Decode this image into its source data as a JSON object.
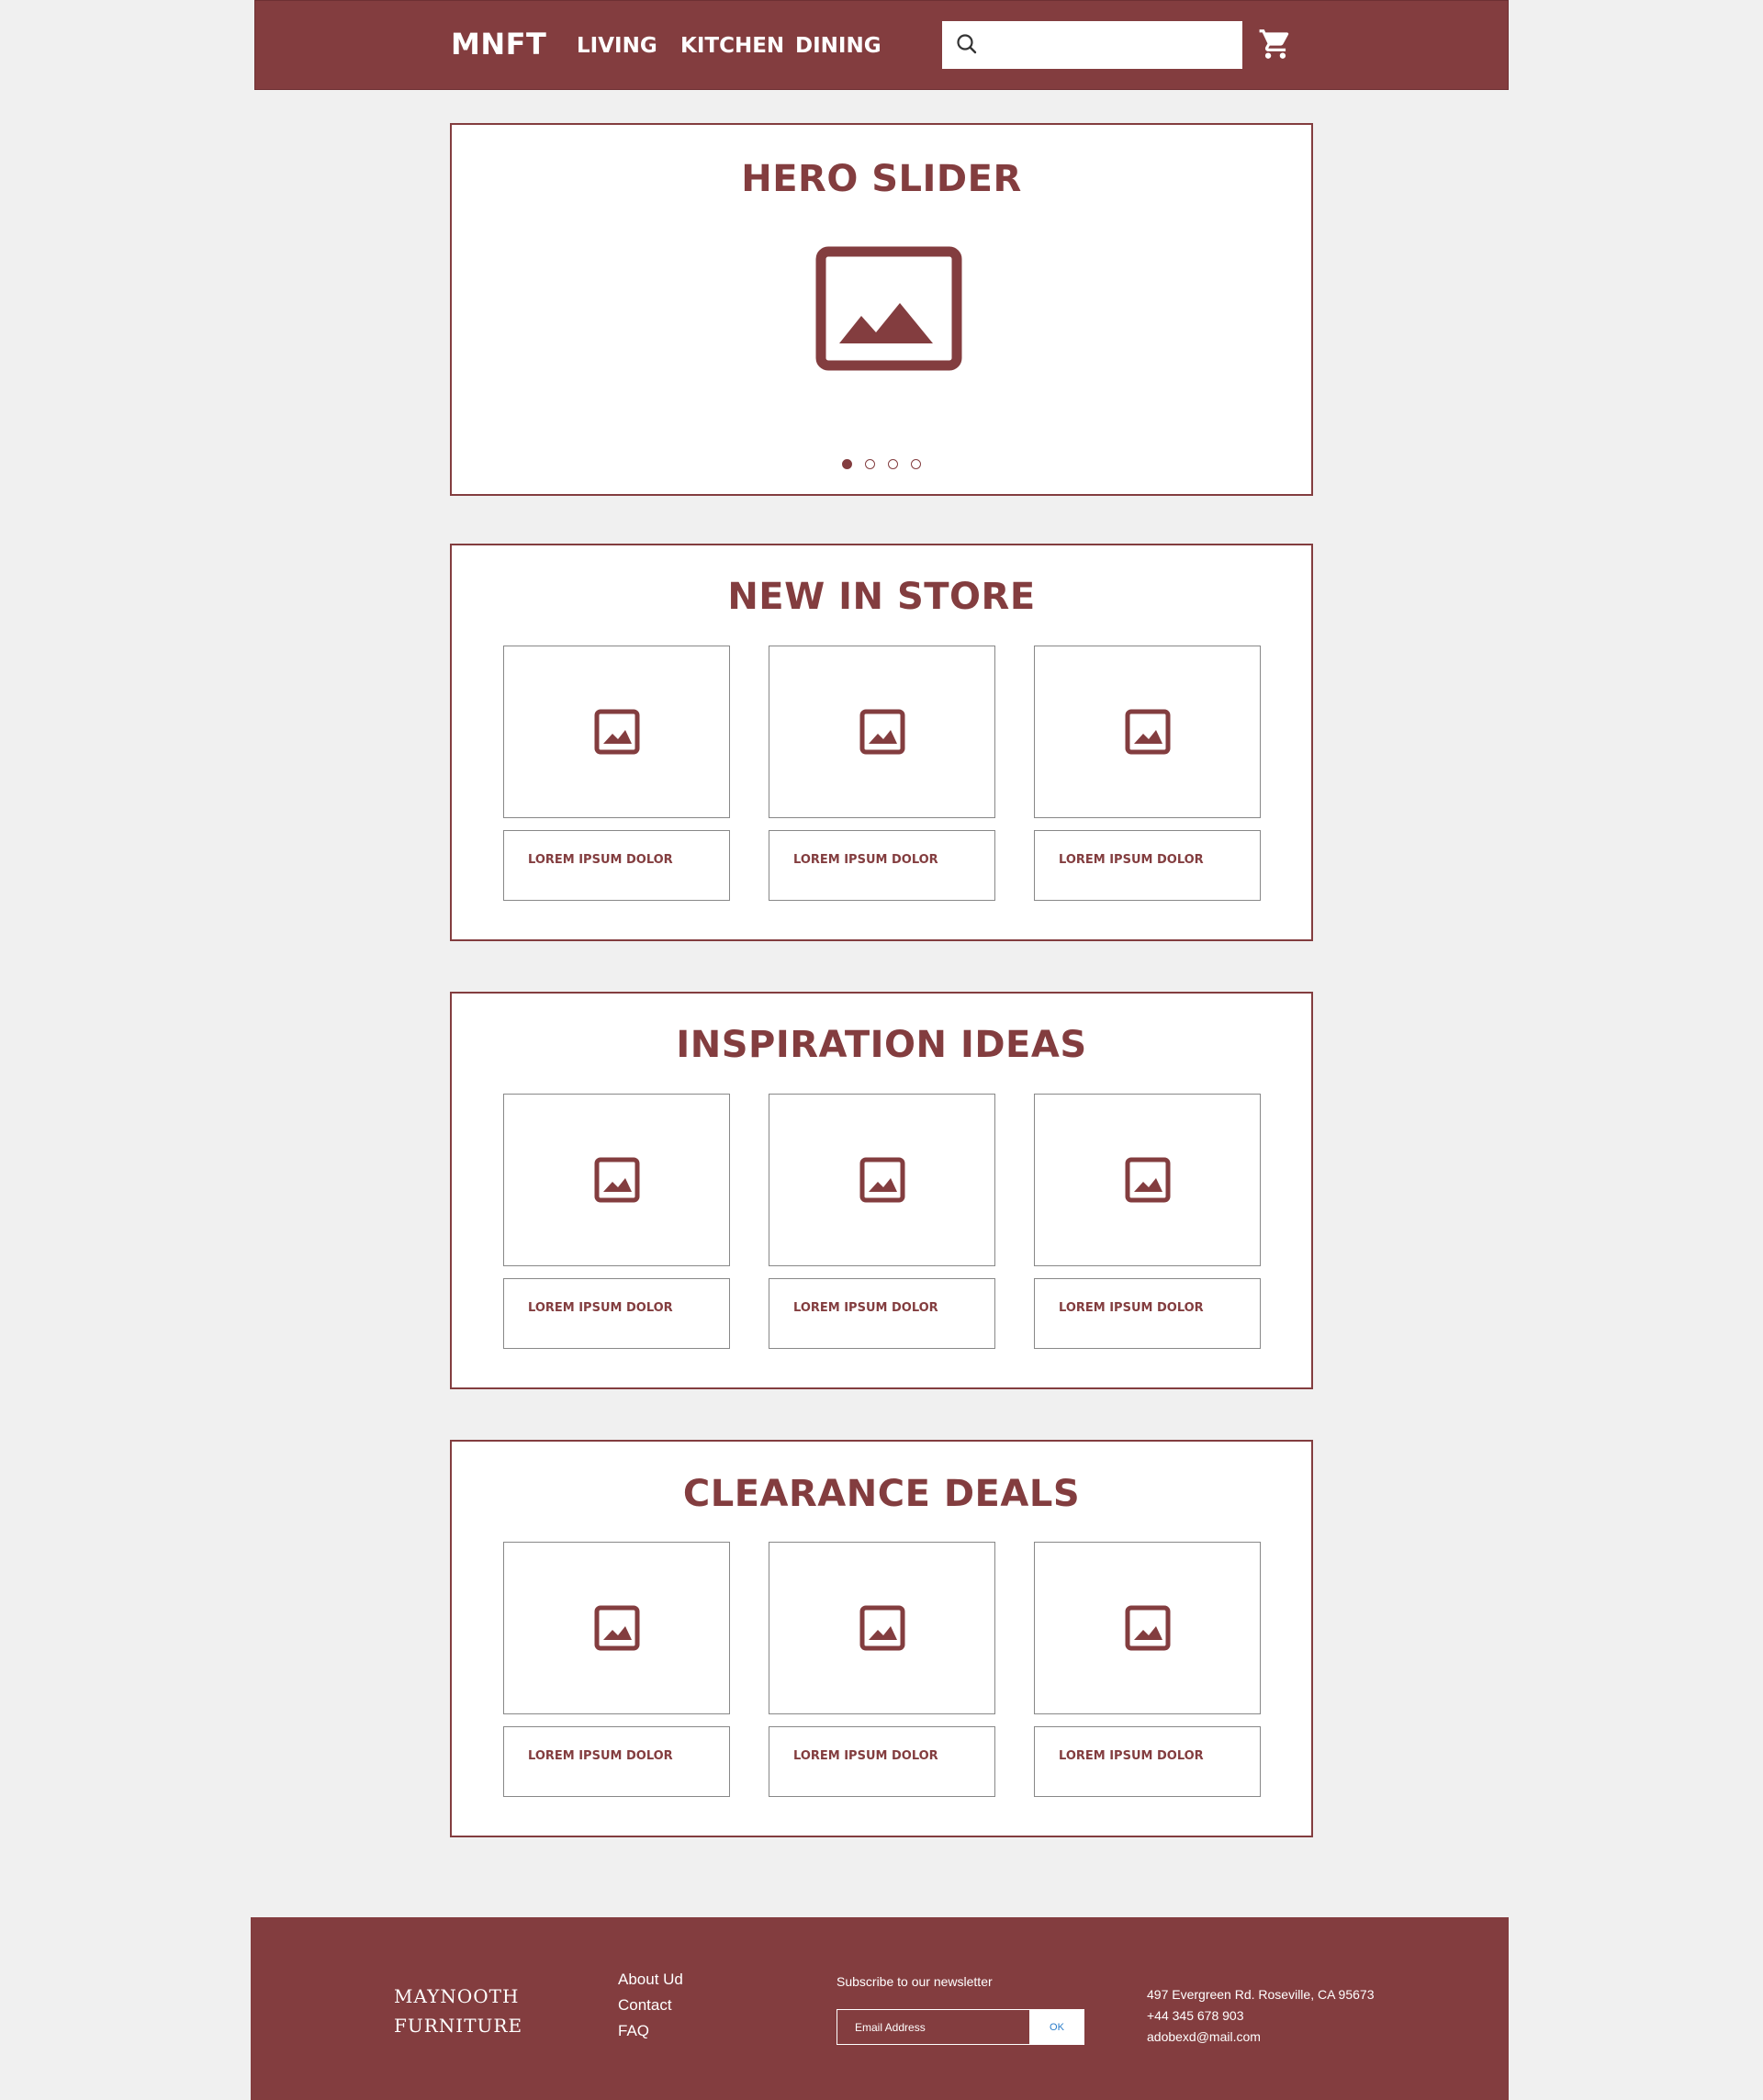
{
  "header": {
    "brand": "MNFT",
    "nav": [
      "LIVING",
      "KITCHEN",
      "DINING"
    ],
    "search": {
      "placeholder": "",
      "value": ""
    },
    "icons": {
      "search": "search-icon",
      "cart": "cart-icon"
    }
  },
  "hero": {
    "title": "HERO SLIDER",
    "image_icon": "image-placeholder-icon",
    "slides_total": 4,
    "active_slide": 1
  },
  "sections": [
    {
      "title": "NEW IN STORE",
      "cards": [
        "LOREM IPSUM DOLOR",
        "LOREM IPSUM DOLOR",
        "LOREM IPSUM DOLOR"
      ]
    },
    {
      "title": "INSPIRATION IDEAS",
      "cards": [
        "LOREM IPSUM DOLOR",
        "LOREM IPSUM DOLOR",
        "LOREM IPSUM DOLOR"
      ]
    },
    {
      "title": "CLEARANCE DEALS",
      "cards": [
        "LOREM IPSUM DOLOR",
        "LOREM IPSUM DOLOR",
        "LOREM IPSUM DOLOR"
      ]
    }
  ],
  "footer": {
    "brand_line1": "MAYNOOTH",
    "brand_line2": "FURNITURE",
    "links": [
      "About Ud",
      "Contact",
      "FAQ"
    ],
    "newsletter": {
      "label": "Subscribe to our newsletter",
      "placeholder": "Email Address",
      "button": "OK"
    },
    "contact": {
      "address": "497 Evergreen Rd. Roseville, CA 95673",
      "phone": "+44 345 678 903",
      "email": "adobexd@mail.com"
    }
  },
  "colors": {
    "brand": "#833d3f",
    "background": "#f0f0f0",
    "card_border": "#888888",
    "ok_text": "#2a7cc9"
  }
}
